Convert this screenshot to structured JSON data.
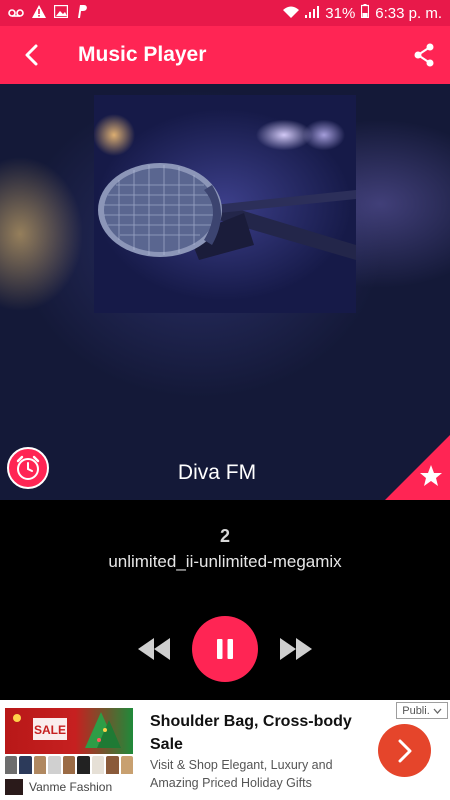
{
  "status_bar": {
    "left_icons": [
      "voicemail-icon",
      "warning-icon",
      "image-icon",
      "paypal-icon"
    ],
    "right_icons": [
      "wifi-icon",
      "signal-icon",
      "battery-icon"
    ],
    "battery": "31%",
    "time": "6:33 p. m."
  },
  "app_bar": {
    "title": "Music Player",
    "back_icon": "back-arrow-icon",
    "share_icon": "share-icon"
  },
  "now_playing": {
    "station": "Diva FM",
    "track_number": "2",
    "track_title": "unlimited_ii-unlimited-megamix",
    "timer_icon": "alarm-clock-icon",
    "favorite_icon": "star-icon"
  },
  "controls": {
    "rewind_icon": "rewind-icon",
    "pause_icon": "pause-icon",
    "forward_icon": "fast-forward-icon"
  },
  "ad": {
    "badge": "Publi.",
    "title": "Shoulder Bag, Cross-body Sale",
    "description": "Visit & Shop Elegant, Luxury and Amazing Priced Holiday Gifts",
    "brand": "Vanme Fashion",
    "image_text": "SALE",
    "cta_icon": "chevron-right-icon"
  },
  "colors": {
    "status_bar": "#e8194a",
    "accent": "#ff2554",
    "background": "#000000",
    "ad_cta": "#e5452b"
  }
}
